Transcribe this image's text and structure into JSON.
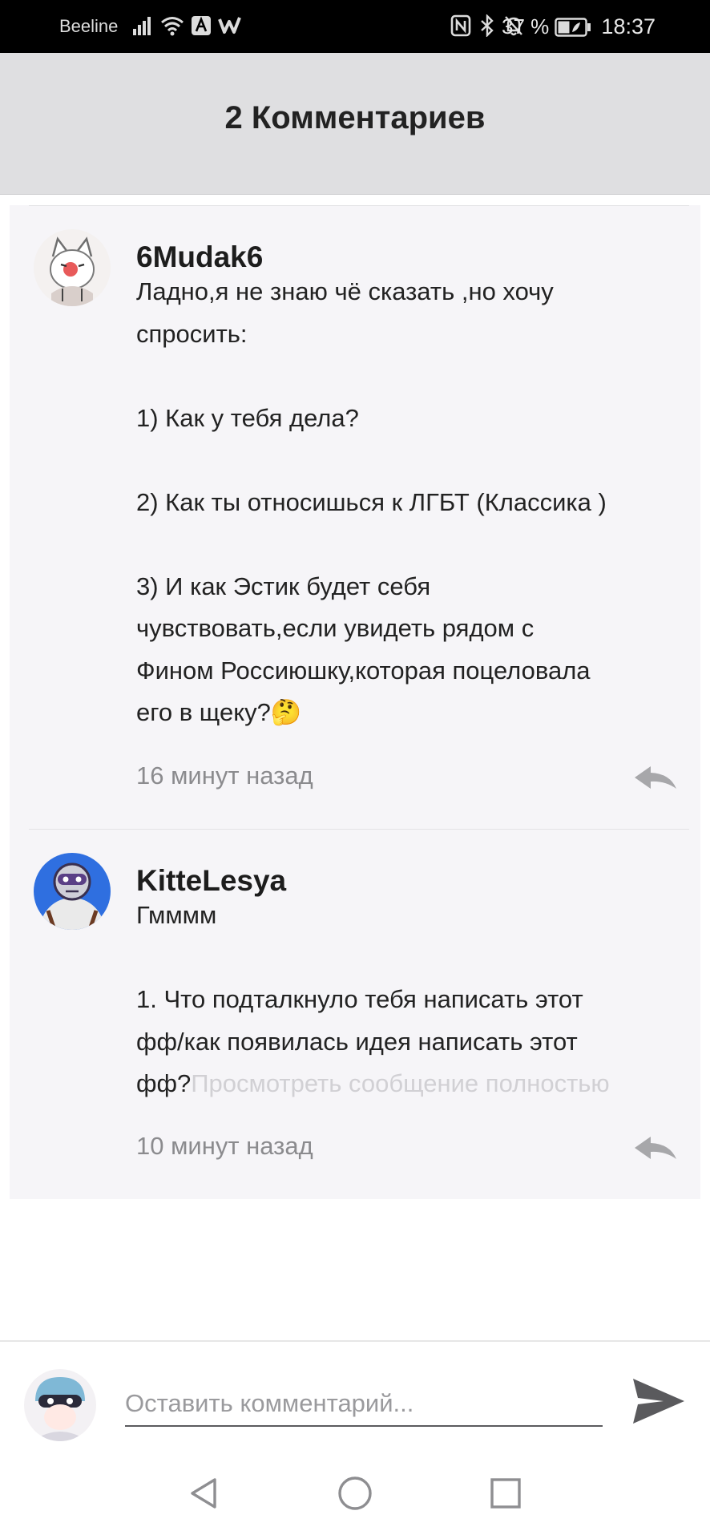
{
  "status_bar": {
    "carrier": "Beeline",
    "battery_percent": "37 %",
    "time": "18:37"
  },
  "header": {
    "title": "2 Комментариев"
  },
  "comments": [
    {
      "username": "6Mudak6",
      "text": "Ладно,я не знаю чё сказать ,но хочу\nспросить:\n\n1) Как у тебя дела?\n\n2) Как ты относишься к ЛГБТ (Классика )\n\n3) И как Эстик будет себя\nчувствовать,если увидеть рядом с\nФином Россиюшку,которая поцеловала\nего в щеку?🤔",
      "time": "16 минут назад"
    },
    {
      "username": "KitteLesya",
      "text": "Гмммм\n\n1. Что подталкнуло тебя написать этот\nфф/как появилась идея написать этот\nфф?",
      "view_full_label": "Просмотреть сообщение полностью",
      "time": "10 минут назад"
    }
  ],
  "composer": {
    "placeholder": "Оставить комментарий...",
    "value": ""
  },
  "icons": {
    "reply": "reply-icon",
    "send": "send-icon",
    "back": "back-icon",
    "home": "home-icon",
    "recents": "recents-icon"
  },
  "colors": {
    "header_bg": "#dfdfe1",
    "list_bg": "#f6f5f8",
    "muted_text": "#8b8b8e",
    "hint_text": "#d1d0d4"
  }
}
